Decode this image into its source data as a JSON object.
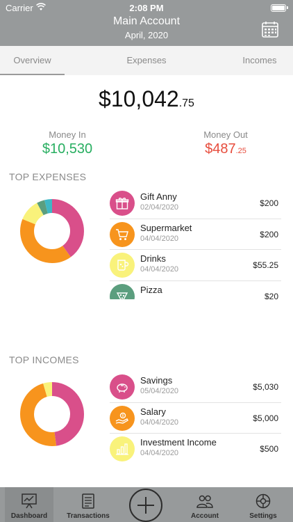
{
  "status": {
    "carrier": "Carrier",
    "time": "2:08 PM"
  },
  "header": {
    "title": "Main Account",
    "subtitle": "April, 2020"
  },
  "tabs": [
    {
      "label": "Overview",
      "active": true
    },
    {
      "label": "Expenses",
      "active": false
    },
    {
      "label": "Incomes",
      "active": false
    }
  ],
  "balance": {
    "main": "$10,042",
    "cents": ".75"
  },
  "money_in": {
    "label": "Money In",
    "value": "$10,530"
  },
  "money_out": {
    "label": "Money Out",
    "value": "$487",
    "cents": ".25"
  },
  "top_expenses": {
    "title": "TOP EXPENSES",
    "items": [
      {
        "name": "Gift Anny",
        "date": "02/04/2020",
        "amount": "$200",
        "icon": "gift-icon",
        "color": "#d94f8a"
      },
      {
        "name": "Supermarket",
        "date": "04/04/2020",
        "amount": "$200",
        "icon": "cart-icon",
        "color": "#f7941d"
      },
      {
        "name": "Drinks",
        "date": "04/04/2020",
        "amount": "$55.25",
        "icon": "drink-icon",
        "color": "#f9f27b"
      },
      {
        "name": "Pizza",
        "date": "",
        "amount": "$20",
        "icon": "pizza-icon",
        "color": "#5b9e7e"
      }
    ]
  },
  "top_incomes": {
    "title": "TOP INCOMES",
    "items": [
      {
        "name": "Savings",
        "date": "05/04/2020",
        "amount": "$5,030",
        "icon": "piggy-bank-icon",
        "color": "#d94f8a"
      },
      {
        "name": "Salary",
        "date": "04/04/2020",
        "amount": "$5,000",
        "icon": "money-hand-icon",
        "color": "#f7941d"
      },
      {
        "name": "Investment Income",
        "date": "04/04/2020",
        "amount": "$500",
        "icon": "chart-bars-icon",
        "color": "#f9f27b"
      }
    ]
  },
  "expenses_donut": [
    {
      "value": 40,
      "color": "#d94f8a"
    },
    {
      "value": 41,
      "color": "#f7941d"
    },
    {
      "value": 11,
      "color": "#f9f27b"
    },
    {
      "value": 4,
      "color": "#5b9e7e"
    },
    {
      "value": 4,
      "color": "#3fb7c4"
    }
  ],
  "incomes_donut": [
    {
      "value": 47.8,
      "color": "#d94f8a"
    },
    {
      "value": 47.5,
      "color": "#f7941d"
    },
    {
      "value": 4.7,
      "color": "#f9f27b"
    }
  ],
  "tabbar": [
    {
      "label": "Dashboard",
      "icon": "dashboard-icon",
      "active": true
    },
    {
      "label": "Transactions",
      "icon": "transactions-icon",
      "active": false
    },
    {
      "label": "Account",
      "icon": "account-icon",
      "active": false
    },
    {
      "label": "Settings",
      "icon": "settings-icon",
      "active": false
    }
  ],
  "colors": {
    "header": "#979a9b",
    "income": "#27ae60",
    "expense": "#e74c3c"
  }
}
